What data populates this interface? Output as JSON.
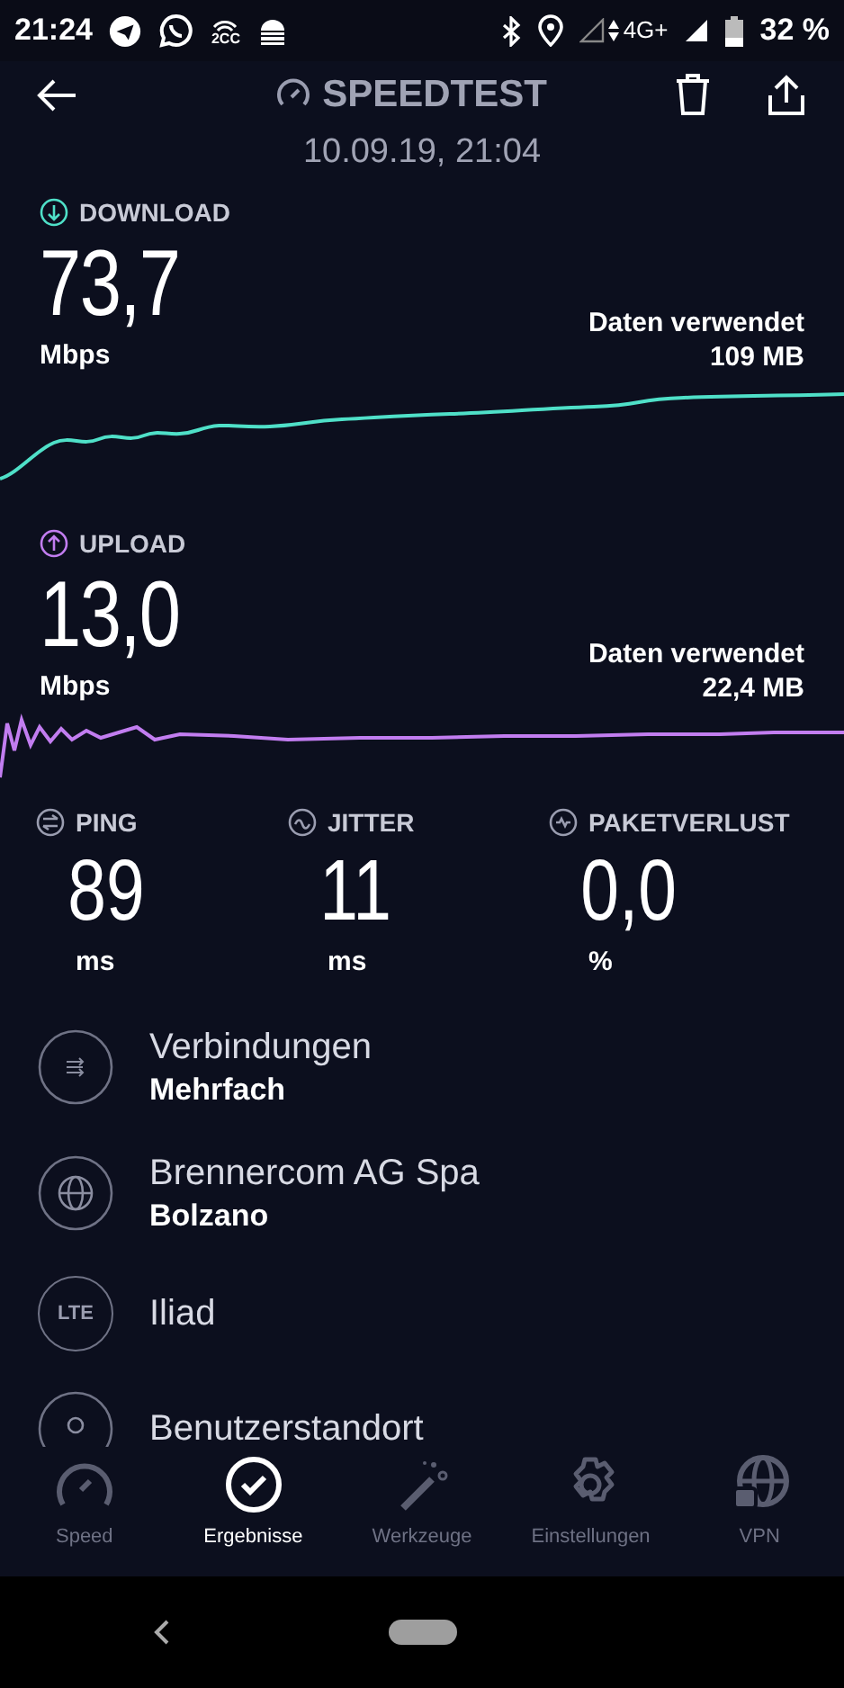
{
  "status_bar": {
    "time": "21:24",
    "notification_label": "2CC",
    "network": "4G+",
    "battery": "32 %"
  },
  "header": {
    "title": "SPEEDTEST",
    "date": "10.09.19, 21:04"
  },
  "results": [
    {
      "kind": "download",
      "label": "DOWNLOAD",
      "value": "73,7",
      "unit": "Mbps",
      "data_label": "Daten verwendet",
      "data_value": "109 MB"
    },
    {
      "kind": "upload",
      "label": "UPLOAD",
      "value": "13,0",
      "unit": "Mbps",
      "data_label": "Daten verwendet",
      "data_value": "22,4 MB"
    }
  ],
  "metrics": [
    {
      "kind": "ping",
      "label": "PING",
      "value": "89",
      "unit": "ms"
    },
    {
      "kind": "jitter",
      "label": "JITTER",
      "value": "11",
      "unit": "ms"
    },
    {
      "kind": "loss",
      "label": "PAKETVERLUST",
      "value": "0,0",
      "unit": "%"
    }
  ],
  "details": [
    {
      "kind": "connections",
      "title": "Verbindungen",
      "subtitle": "Mehrfach"
    },
    {
      "kind": "server",
      "title": "Brennercom AG Spa",
      "subtitle": "Bolzano"
    },
    {
      "kind": "network",
      "icon_text": "LTE",
      "title": "Iliad"
    },
    {
      "kind": "location",
      "title": "Benutzerstandort"
    }
  ],
  "tabs": [
    {
      "kind": "speed",
      "label": "Speed",
      "selected": false
    },
    {
      "kind": "results",
      "label": "Ergebnisse",
      "selected": true
    },
    {
      "kind": "tools",
      "label": "Werkzeuge",
      "selected": false
    },
    {
      "kind": "settings",
      "label": "Einstellungen",
      "selected": false
    },
    {
      "kind": "vpn",
      "label": "VPN",
      "selected": false
    }
  ]
}
